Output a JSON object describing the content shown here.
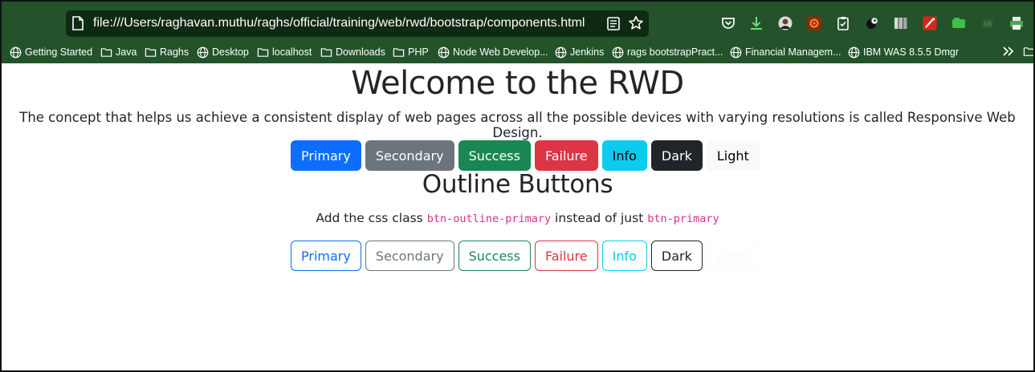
{
  "browser": {
    "url": "file:///Users/raghavan.muthu/raghs/official/training/web/rwd/bootstrap/components.html",
    "toolbar_icons": [
      "pocket-icon",
      "download-icon",
      "profile-avatar-icon",
      "extension-gear-icon",
      "clipboard-icon",
      "extension-ball-icon",
      "reader-book-icon",
      "extension-red-icon",
      "extension-green-icon",
      "extension-dim-icon",
      "extension-printer-icon"
    ],
    "bookmarks": [
      {
        "label": "Getting Started",
        "icon": "globe-icon"
      },
      {
        "label": "Java",
        "icon": "folder-icon"
      },
      {
        "label": "Raghs",
        "icon": "folder-icon"
      },
      {
        "label": "Desktop",
        "icon": "globe-icon"
      },
      {
        "label": "localhost",
        "icon": "folder-icon"
      },
      {
        "label": "Downloads",
        "icon": "folder-icon"
      },
      {
        "label": "PHP",
        "icon": "folder-icon"
      },
      {
        "label": "Node Web Develop...",
        "icon": "globe-icon"
      },
      {
        "label": "Jenkins",
        "icon": "globe-icon"
      },
      {
        "label": "rags bootstrapPract...",
        "icon": "globe-icon"
      },
      {
        "label": "Financial Managem...",
        "icon": "globe-icon"
      },
      {
        "label": "IBM WAS 8.5.5 Dmgr",
        "icon": "globe-icon"
      }
    ]
  },
  "page": {
    "title": "Welcome to the RWD",
    "lead": "The concept that helps us achieve a consistent display of web pages across all the possible devices with varying resolutions is called Responsive Web Design.",
    "outline_title": "Outline Buttons",
    "note_prefix": "Add the css class ",
    "note_code1": "btn-outline-primary",
    "note_middle": " instead of just ",
    "note_code2": "btn-primary"
  },
  "buttons": [
    {
      "label": "Primary",
      "color": "#0d6efd"
    },
    {
      "label": "Secondary",
      "color": "#6c757d"
    },
    {
      "label": "Success",
      "color": "#198754"
    },
    {
      "label": "Failure",
      "color": "#dc3545"
    },
    {
      "label": "Info",
      "color": "#0dcaf0"
    },
    {
      "label": "Dark",
      "color": "#212529"
    },
    {
      "label": "Light",
      "color": "#f8f9fa"
    }
  ],
  "outline_buttons": [
    {
      "label": "Primary",
      "color": "#0d6efd"
    },
    {
      "label": "Secondary",
      "color": "#6c757d"
    },
    {
      "label": "Success",
      "color": "#198754"
    },
    {
      "label": "Failure",
      "color": "#dc3545"
    },
    {
      "label": "Info",
      "color": "#0dcaf0"
    },
    {
      "label": "Dark",
      "color": "#212529"
    },
    {
      "label": "Light",
      "color": "#f8f9fa"
    }
  ]
}
